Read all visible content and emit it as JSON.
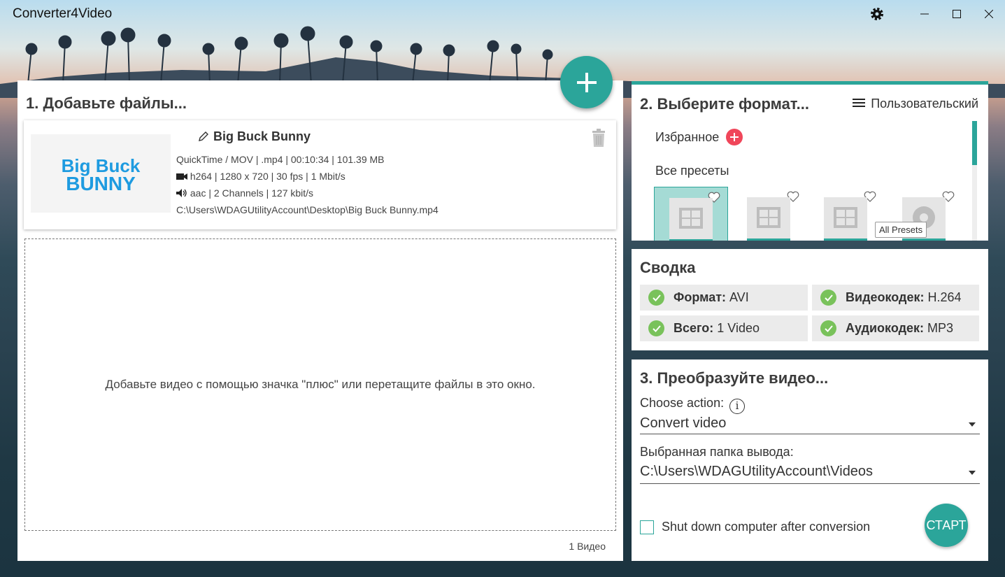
{
  "app": {
    "title": "Converter4Video"
  },
  "colors": {
    "accent": "#2ba59a",
    "favorite_plus": "#f0465a",
    "check_green": "#79c25b"
  },
  "titlebar": {
    "icons": [
      "gear-icon",
      "minimize-icon",
      "maximize-icon",
      "close-icon"
    ]
  },
  "add_files": {
    "title": "1. Добавьте файлы...",
    "file": {
      "thumbnail_text": [
        "Big Buck",
        "BUNNY"
      ],
      "name": "Big Buck Bunny",
      "container": "QuickTime / MOV | .mp4 | 00:10:34 | 101.39 MB",
      "video": "h264 | 1280 x 720 | 30 fps | 1 Mbit/s",
      "audio": "aac | 2 Channels | 127 kbit/s",
      "path": "C:\\Users\\WDAGUtilityAccount\\Desktop\\Big Buck Bunny.mp4"
    },
    "dropzone_text": "Добавьте видео с помощью значка \"плюс\" или перетащите файлы в это окно.",
    "count": "1 Видео"
  },
  "format": {
    "title": "2. Выберите формат...",
    "menu_label": "Пользовательский",
    "favorites_label": "Избранное",
    "all_presets_label": "Все пресеты",
    "tooltip": "All Presets",
    "presets": [
      {
        "icon": "film-icon",
        "selected": true
      },
      {
        "icon": "film-icon",
        "selected": false
      },
      {
        "icon": "film-icon",
        "selected": false
      },
      {
        "icon": "disc-icon",
        "selected": false
      }
    ]
  },
  "summary": {
    "title": "Сводка",
    "items": [
      {
        "label": "Формат:",
        "value": "AVI"
      },
      {
        "label": "Видеокодек:",
        "value": "H.264"
      },
      {
        "label": "Всего:",
        "value": "1 Video"
      },
      {
        "label": "Аудиокодек:",
        "value": "MP3"
      }
    ]
  },
  "convert": {
    "title": "3. Преобразуйте видео...",
    "action_label": "Choose action:",
    "action_value": "Convert video",
    "output_label": "Выбранная папка вывода:",
    "output_value": "C:\\Users\\WDAGUtilityAccount\\Videos",
    "shutdown_label": "Shut down computer after conversion",
    "shutdown_checked": false,
    "start_label": "СТАРТ"
  }
}
